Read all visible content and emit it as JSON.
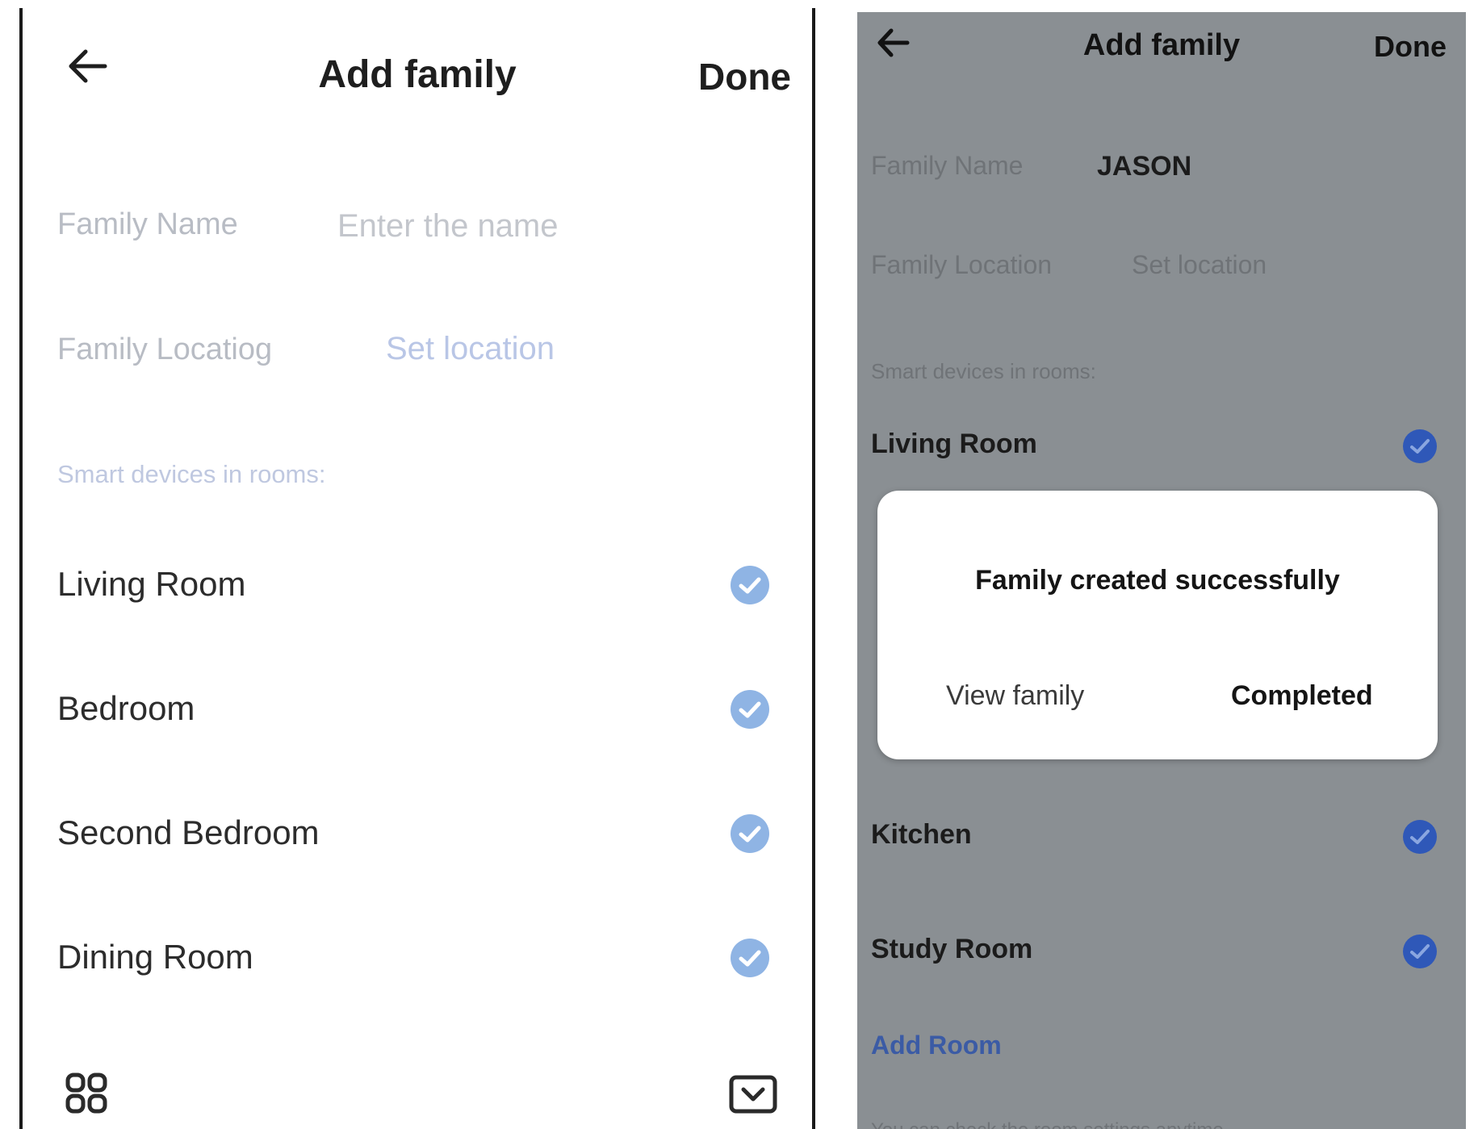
{
  "left_screen": {
    "header": {
      "title": "Add family",
      "done_label": "Done"
    },
    "family_name": {
      "label": "Family Name",
      "placeholder": "Enter the name"
    },
    "family_location": {
      "label": "Family Locatiog",
      "value": "Set location"
    },
    "section_label": "Smart devices in rooms:",
    "rooms": [
      {
        "name": "Living Room",
        "checked": true
      },
      {
        "name": "Bedroom",
        "checked": true
      },
      {
        "name": "Second Bedroom",
        "checked": true
      },
      {
        "name": "Dining Room",
        "checked": true
      }
    ],
    "icons": [
      "back-arrow-icon",
      "grid-icon",
      "keyboard-hide-icon",
      "check-circle-icon"
    ],
    "colors": {
      "check": "#8fb4e4",
      "label": "#b8bcc4",
      "link": "#b9c6e6"
    }
  },
  "right_screen": {
    "header": {
      "title": "Add family",
      "done_label": "Done"
    },
    "family_name": {
      "label": "Family Name",
      "value": "JASON"
    },
    "family_location": {
      "label": "Family Location",
      "value": "Set location"
    },
    "section_label": "Smart devices in rooms:",
    "rooms": [
      {
        "name": "Living Room",
        "checked": true
      },
      {
        "name": "Kitchen",
        "checked": true
      },
      {
        "name": "Study Room",
        "checked": true
      }
    ],
    "add_room_label": "Add Room",
    "footer_text": "You can check the room settings anytime",
    "dialog": {
      "message": "Family created successfully",
      "view_label": "View family",
      "completed_label": "Completed"
    },
    "colors": {
      "background": "#8a8f93",
      "check": "#2f58b8",
      "add_room": "#3b5ba5"
    }
  }
}
